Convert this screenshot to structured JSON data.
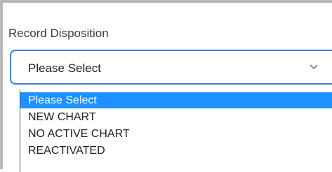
{
  "field": {
    "label": "Record Disposition",
    "selected_value": "Please Select"
  },
  "dropdown": {
    "options": [
      {
        "label": "Please Select",
        "selected": true
      },
      {
        "label": "NEW CHART",
        "selected": false
      },
      {
        "label": "NO ACTIVE CHART",
        "selected": false
      },
      {
        "label": "REACTIVATED",
        "selected": false
      }
    ],
    "highlight_color": "#1e90ff",
    "focus_border_color": "#3d7ee8"
  },
  "icons": {
    "dropdown": "chevron-down-icon"
  }
}
